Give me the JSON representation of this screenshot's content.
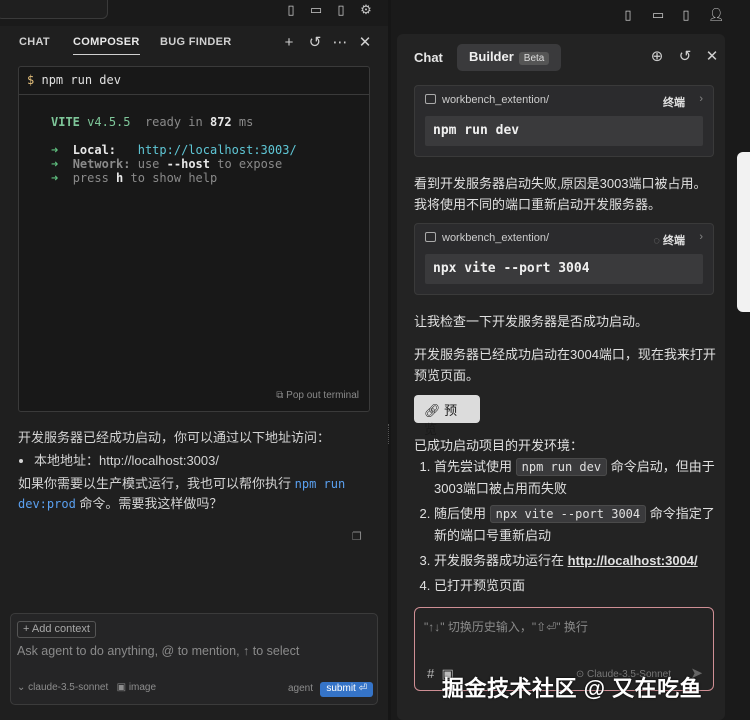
{
  "left": {
    "tabs": [
      "CHAT",
      "COMPOSER",
      "BUG FINDER"
    ],
    "icons": [
      "plus-icon",
      "history-icon",
      "more-icon",
      "close-icon"
    ],
    "terminal": {
      "command": "npm run dev",
      "vite_label": "VITE",
      "vite_version": "v4.5.5",
      "ready_text": "ready in",
      "ready_ms": "872",
      "ms": "ms",
      "local_label": "Local:",
      "local_url": "http://localhost:3003/",
      "network_label": "Network:",
      "network_use": "use",
      "network_flag": "--host",
      "network_rest": "to expose",
      "help_prefix": "press",
      "help_key": "h",
      "help_rest": "to show help",
      "popout": "Pop out terminal"
    },
    "message": {
      "line1": "开发服务器已经成功启动，你可以通过以下地址访问：",
      "bullet": "本地地址：http://localhost:3003/",
      "line2_pre": "如果你需要以生产模式运行，我也可以帮你执行 ",
      "line2_code": "npm run dev:prod",
      "line2_post": " 命令。需要我这样做吗？"
    },
    "composer": {
      "add_context": "+ Add context",
      "placeholder": "Ask agent to do anything, @ to mention, ↑ to select",
      "model": "claude-3.5-sonnet",
      "image": "image",
      "agent": "agent",
      "submit": "submit ⏎"
    }
  },
  "right": {
    "tab_chat": "Chat",
    "tab_builder": "Builder",
    "beta": "Beta",
    "card1": {
      "path": "workbench_extention/",
      "label": "终端",
      "command": "npm run dev"
    },
    "text1": "看到开发服务器启动失败,原因是3003端口被占用。我将使用不同的端口重新启动开发服务器。",
    "card2": {
      "path": "workbench_extention/",
      "label": "终端",
      "command": "npx vite --port 3004"
    },
    "text2": "让我检查一下开发服务器是否成功启动。",
    "text3": "开发服务器已经成功启动在3004端口，现在我来打开预览页面。",
    "preview_button": "预览",
    "summary_title": "已成功启动项目的开发环境：",
    "steps": [
      {
        "pre": "首先尝试使用 ",
        "code": "npm run dev",
        "post": " 命令启动，但由于3003端口被占用而失败"
      },
      {
        "pre": "随后使用 ",
        "code": "npx vite --port 3004",
        "post": " 命令指定了新的端口号重新启动"
      },
      {
        "pre": "开发服务器成功运行在 ",
        "link": "http://localhost:3004/"
      },
      {
        "pre": "已打开预览页面"
      }
    ],
    "input_placeholder": "\"↑↓\" 切换历史输入，\"⇧⏎\" 换行",
    "input_hash": "#",
    "input_model": "Claude-3.5-Sonnet"
  },
  "watermark": "掘金技术社区 @ 又在吃鱼"
}
